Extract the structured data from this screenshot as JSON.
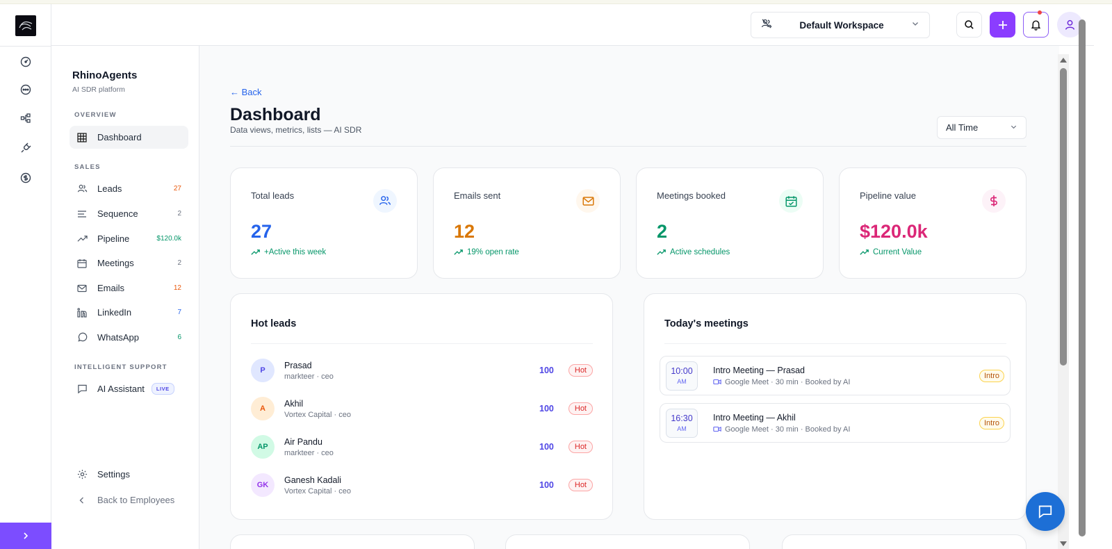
{
  "topbar": {
    "workspace_label": "Default Workspace"
  },
  "sidebar": {
    "brand": "RhinoAgents",
    "brand_sub": "AI SDR platform",
    "section_overview": "OVERVIEW",
    "section_sales": "SALES",
    "section_support": "INTELLIGENT SUPPORT",
    "dashboard_label": "Dashboard",
    "sales_items": [
      {
        "label": "Leads",
        "count": "27",
        "count_color": "#ea580c"
      },
      {
        "label": "Sequence",
        "count": "2",
        "count_color": "#6b7280"
      },
      {
        "label": "Pipeline",
        "count": "$120.0k",
        "count_color": "#059669"
      },
      {
        "label": "Meetings",
        "count": "2",
        "count_color": "#6b7280"
      },
      {
        "label": "Emails",
        "count": "12",
        "count_color": "#ea580c"
      },
      {
        "label": "LinkedIn",
        "count": "7",
        "count_color": "#2563eb"
      },
      {
        "label": "WhatsApp",
        "count": "6",
        "count_color": "#059669"
      }
    ],
    "assistant_label": "AI Assistant",
    "live_badge": "LIVE",
    "settings_label": "Settings",
    "back_label": "Back to Employees"
  },
  "header": {
    "back": "← Back",
    "title": "Dashboard",
    "subtitle": "Data views, metrics, lists — AI SDR",
    "range": "All Time"
  },
  "stats": [
    {
      "label": "Total leads",
      "value": "27",
      "note": "+Active this week",
      "color": "#2563eb",
      "icon_bg": "#eff6ff",
      "icon": "users-icon"
    },
    {
      "label": "Emails sent",
      "value": "12",
      "note": "19% open rate",
      "color": "#d97706",
      "icon_bg": "#fff7ed",
      "icon": "mail-icon"
    },
    {
      "label": "Meetings booked",
      "value": "2",
      "note": "Active schedules",
      "color": "#059669",
      "icon_bg": "#ecfdf5",
      "icon": "calendar-check-icon"
    },
    {
      "label": "Pipeline value",
      "value": "$120.0k",
      "note": "Current Value",
      "color": "#db2777",
      "icon_bg": "#fdf2f8",
      "icon": "dollar-icon"
    }
  ],
  "hot_leads": {
    "title": "Hot leads",
    "items": [
      {
        "initials": "P",
        "name": "Prasad",
        "sub": "markteer · ceo",
        "score": "100",
        "tag": "Hot",
        "bg": "#e0e7ff",
        "fg": "#4f46e5"
      },
      {
        "initials": "A",
        "name": "Akhil",
        "sub": "Vortex Capital · ceo",
        "score": "100",
        "tag": "Hot",
        "bg": "#ffedd5",
        "fg": "#ea580c"
      },
      {
        "initials": "AP",
        "name": "Air Pandu",
        "sub": "markteer · ceo",
        "score": "100",
        "tag": "Hot",
        "bg": "#d1fae5",
        "fg": "#059669"
      },
      {
        "initials": "GK",
        "name": "Ganesh Kadali",
        "sub": "Vortex Capital · ceo",
        "score": "100",
        "tag": "Hot",
        "bg": "#f3e8ff",
        "fg": "#9333ea"
      }
    ]
  },
  "meetings": {
    "title": "Today's meetings",
    "items": [
      {
        "time": "10:00",
        "ampm": "AM",
        "title": "Intro Meeting — Prasad",
        "detail": "Google Meet · 30 min · Booked by AI",
        "tag": "Intro"
      },
      {
        "time": "16:30",
        "ampm": "AM",
        "title": "Intro Meeting — Akhil",
        "detail": "Google Meet · 30 min · Booked by AI",
        "tag": "Intro"
      }
    ]
  }
}
